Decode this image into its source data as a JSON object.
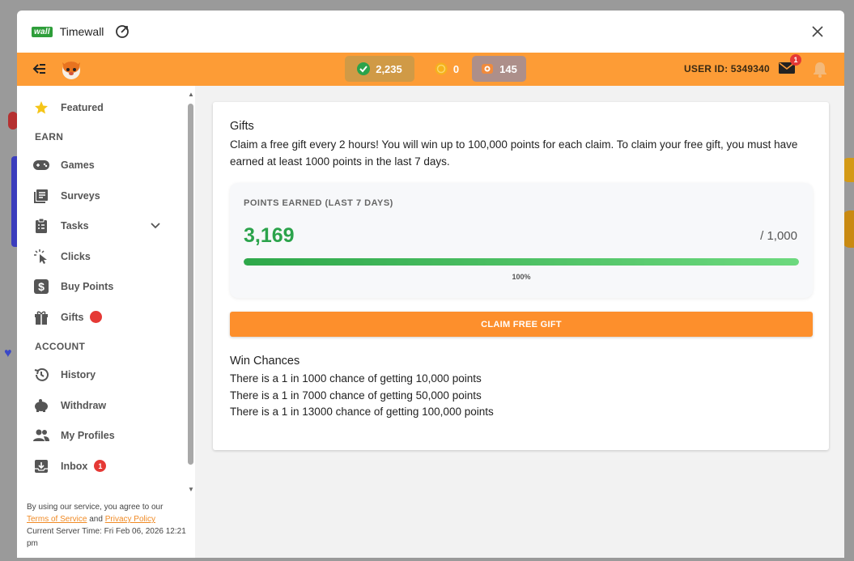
{
  "modal": {
    "logo_text": "wall",
    "title": "Timewall"
  },
  "topbar": {
    "balances": [
      {
        "icon": "check-circle-icon",
        "value": "2,235",
        "color": "#2ba34b"
      },
      {
        "icon": "coin-icon",
        "value": "0",
        "color": "#f5b21d"
      },
      {
        "icon": "ticket-icon",
        "value": "145",
        "color": "#ad8f8a"
      }
    ],
    "user_id": "USER ID: 5349340",
    "mail_badge": "1"
  },
  "sidebar": {
    "featured": "Featured",
    "earn_section": "EARN",
    "earn_items": [
      {
        "icon": "gamepad-icon",
        "label": "Games"
      },
      {
        "icon": "survey-list-icon",
        "label": "Surveys"
      },
      {
        "icon": "clipboard-icon",
        "label": "Tasks"
      },
      {
        "icon": "click-icon",
        "label": "Clicks"
      },
      {
        "icon": "dollar-icon",
        "label": "Buy Points"
      },
      {
        "icon": "gift-icon",
        "label": "Gifts"
      }
    ],
    "account_section": "ACCOUNT",
    "account_items": [
      {
        "icon": "history-icon",
        "label": "History"
      },
      {
        "icon": "piggy-bank-icon",
        "label": "Withdraw"
      },
      {
        "icon": "people-icon",
        "label": "My Profiles"
      },
      {
        "icon": "inbox-icon",
        "label": "Inbox",
        "badge": "1"
      }
    ],
    "footer": {
      "line1": "By using our service, you agree to our",
      "terms": "Terms of Service",
      "and": "and",
      "privacy": "Privacy Policy",
      "server_time": "Current Server Time: Fri Feb 06, 2026 12:21 pm"
    }
  },
  "gifts": {
    "title": "Gifts",
    "description": "Claim a free gift every 2 hours! You will win up to 100,000 points for each claim. To claim your free gift, you must have earned at least 1000 points in the last 7 days.",
    "points_label": "POINTS EARNED (LAST 7 DAYS)",
    "points_value": "3,169",
    "points_goal": "/ 1,000",
    "progress_fraction": 1.0,
    "progress_text": "100%",
    "claim_button": "CLAIM FREE GIFT",
    "win_title": "Win Chances",
    "win_lines": [
      "There is a 1 in 1000 chance of getting 10,000 points",
      "There is a 1 in 7000 chance of getting 50,000 points",
      "There is a 1 in 13000 chance of getting 100,000 points"
    ]
  },
  "colors": {
    "accent": "#fd9c36",
    "success": "#2ba34b",
    "badge": "#e53935"
  }
}
